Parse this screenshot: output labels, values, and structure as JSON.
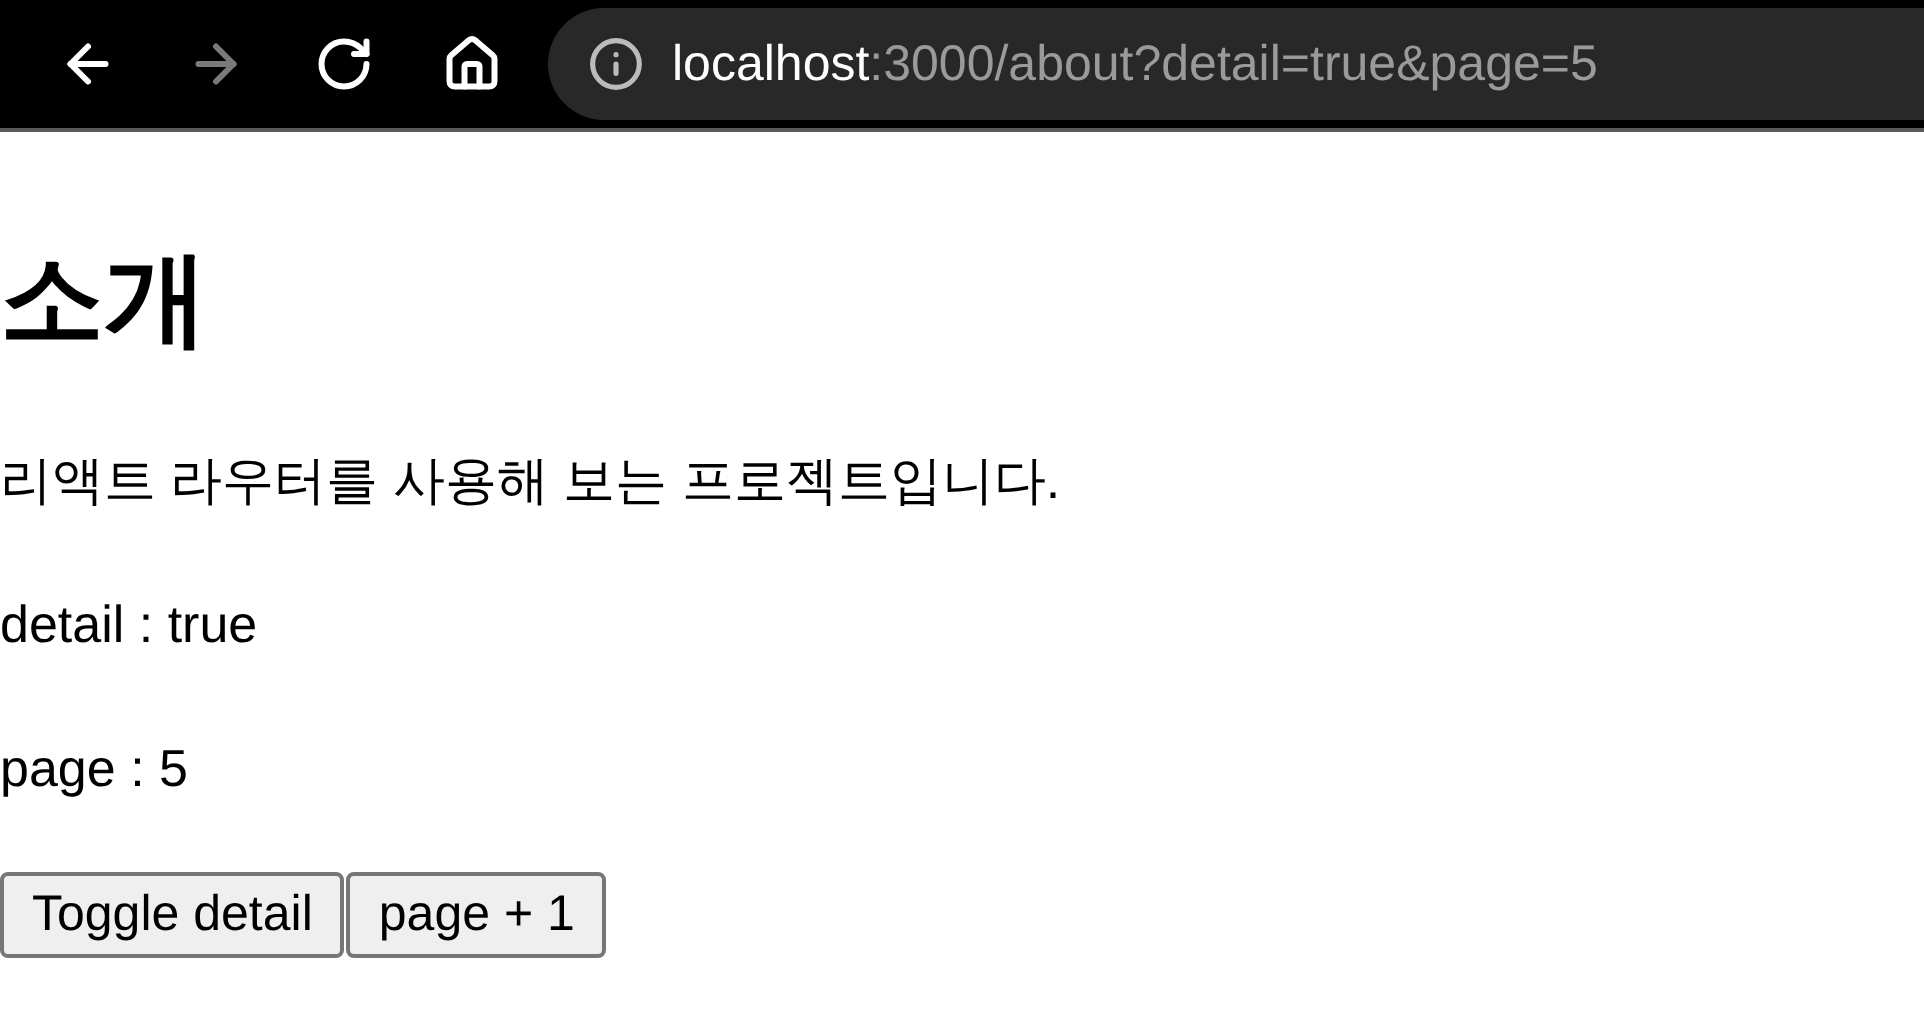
{
  "browser": {
    "nav_buttons": [
      {
        "kind": "back",
        "disabled": false
      },
      {
        "kind": "forward",
        "disabled": true
      },
      {
        "kind": "reload",
        "disabled": false
      },
      {
        "kind": "home",
        "disabled": false
      }
    ],
    "address": {
      "host": "localhost",
      "rest": ":3000/about?detail=true&page=5"
    }
  },
  "page": {
    "heading": "소개",
    "description": "리액트 라우터를 사용해 보는 프로젝트입니다.",
    "lines": [
      "detail : true",
      "page : 5"
    ],
    "buttons": [
      "Toggle detail",
      "page + 1"
    ]
  }
}
